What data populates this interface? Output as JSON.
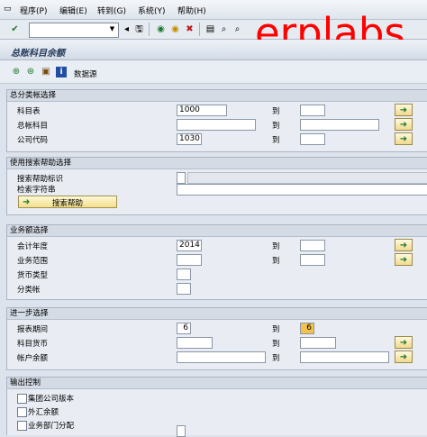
{
  "menu": {
    "items": [
      {
        "label": "程序(P)"
      },
      {
        "label": "编辑(E)"
      },
      {
        "label": "转到(G)"
      },
      {
        "label": "系统(Y)"
      },
      {
        "label": "帮助(H)"
      }
    ]
  },
  "toolbar": {
    "command_value": ""
  },
  "watermark": "erplabs",
  "page": {
    "title": "总账科目余额"
  },
  "app_toolbar": {
    "data_source_label": "数据源"
  },
  "sections": {
    "gl": {
      "title": "总分类帐选择",
      "rows": [
        {
          "label": "科目表",
          "from": "1000",
          "to_label": "到",
          "to": ""
        },
        {
          "label": "总帐科目",
          "from": "",
          "to_label": "到",
          "to": ""
        },
        {
          "label": "公司代码",
          "from": "1030",
          "to_label": "到",
          "to": ""
        }
      ]
    },
    "search": {
      "title": "使用搜索帮助选择",
      "id_label": "搜索帮助标识",
      "string_label": "检索字符串",
      "button_label": "搜索帮助"
    },
    "amount": {
      "title": "业务额选择",
      "rows": [
        {
          "label": "会计年度",
          "from": "2014",
          "to_label": "到",
          "to": ""
        },
        {
          "label": "业务范围",
          "from": "",
          "to_label": "到",
          "to": ""
        },
        {
          "label": "货币类型",
          "from": ""
        },
        {
          "label": "分类帐",
          "from": ""
        }
      ]
    },
    "further": {
      "title": "进一步选择",
      "rows": [
        {
          "label": "报表期间",
          "from": "6",
          "to_label": "到",
          "to": "6"
        },
        {
          "label": "科目货币",
          "from": "",
          "to_label": "到",
          "to": ""
        },
        {
          "label": "帐户余额",
          "from": "",
          "to_label": "到",
          "to": ""
        }
      ]
    },
    "output": {
      "title": "输出控制",
      "checkboxes": [
        {
          "label": "集团公司版本"
        },
        {
          "label": "外汇余额"
        },
        {
          "label": "业务部门分配"
        }
      ]
    }
  }
}
